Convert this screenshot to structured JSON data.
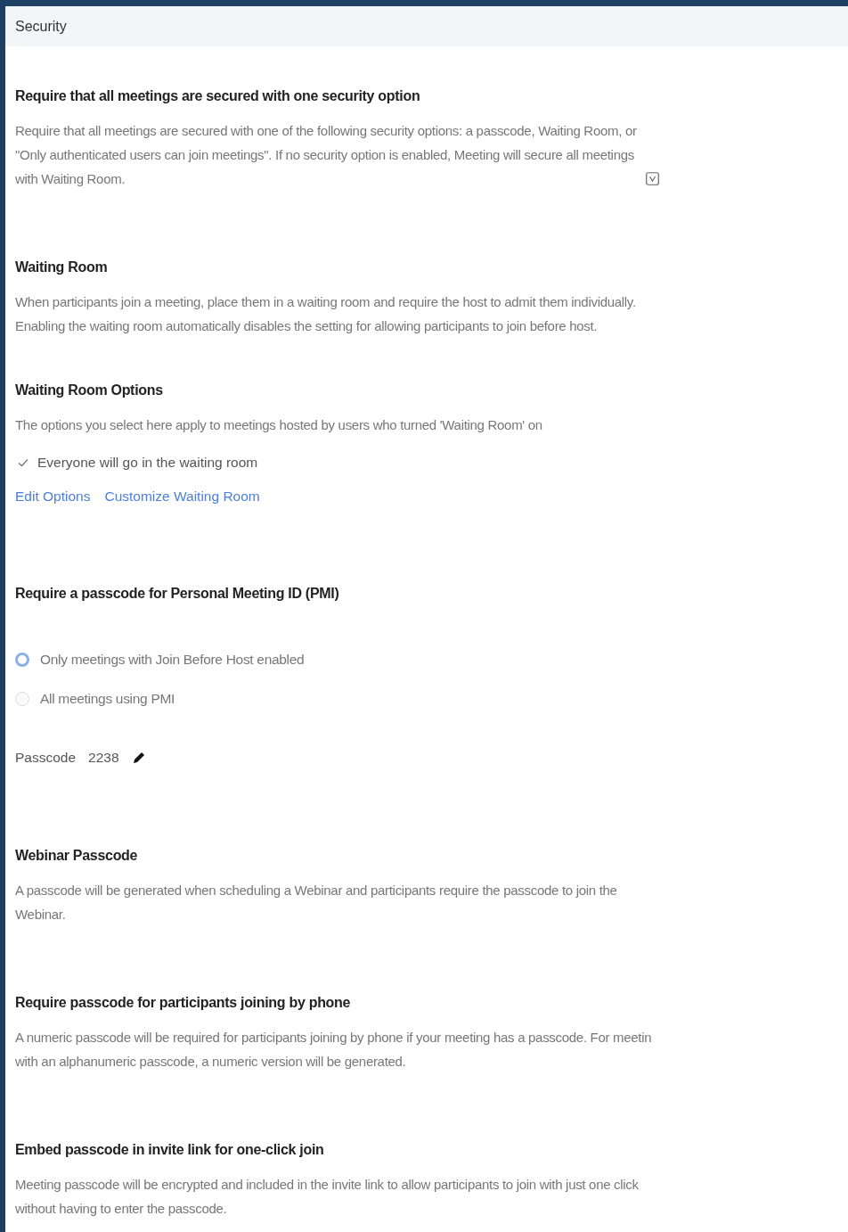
{
  "header": {
    "title": "Security"
  },
  "sections": [
    {
      "items": [
        {
          "kind": "title",
          "text": "Require that all meetings are secured with one security option"
        },
        {
          "kind": "description",
          "text": "Require that all meetings are secured with one of the following security options: a passcode, Waiting Room, or\n\"Only authenticated users can join meetings\". If no security option is enabled, Meeting will secure all meetings\nwith Waiting Room.",
          "icon": true
        }
      ]
    },
    {
      "items": [
        {
          "kind": "title",
          "text": "Waiting Room"
        },
        {
          "kind": "description",
          "text": "When participants join a meeting, place them in a waiting room and require the host to admit them individually.\nEnabling the waiting room automatically disables the setting for allowing participants to join before host."
        }
      ]
    },
    {
      "items": [
        {
          "kind": "title",
          "text": "Waiting Room Options"
        },
        {
          "kind": "description",
          "text": "The options you select here apply to meetings hosted by users who turned 'Waiting Room' on"
        },
        {
          "kind": "check",
          "text": "Everyone will go in the waiting room",
          "checked": true
        },
        {
          "kind": "links",
          "links": [
            "Edit Options",
            "Customize Waiting Room"
          ]
        }
      ]
    },
    {
      "items": [
        {
          "kind": "title",
          "text": "Require a passcode for Personal Meeting ID (PMI)"
        },
        {
          "kind": "radio",
          "text": "Only meetings with Join Before Host enabled",
          "selected": true
        },
        {
          "kind": "radio",
          "text": "All meetings using PMI",
          "selected": false
        },
        {
          "kind": "passcode",
          "label": "Passcode",
          "value": "2238"
        }
      ]
    },
    {
      "items": [
        {
          "kind": "title",
          "text": "Webinar Passcode"
        },
        {
          "kind": "description",
          "text": "A passcode will be generated when scheduling a Webinar and participants require the passcode to join the\nWebinar."
        }
      ]
    },
    {
      "items": [
        {
          "kind": "title",
          "text": "Require passcode for participants joining by phone"
        },
        {
          "kind": "description",
          "text": "A numeric passcode will be required for participants joining by phone if your meeting has a passcode. For meetin\nwith an alphanumeric passcode, a numeric version will be generated."
        }
      ]
    },
    {
      "items": [
        {
          "kind": "title",
          "text": "Embed passcode in invite link for one-click join"
        },
        {
          "kind": "description",
          "text": "Meeting passcode will be encrypted and included in the invite link to allow participants to join with just one click\nwithout having to enter the passcode."
        }
      ]
    }
  ]
}
